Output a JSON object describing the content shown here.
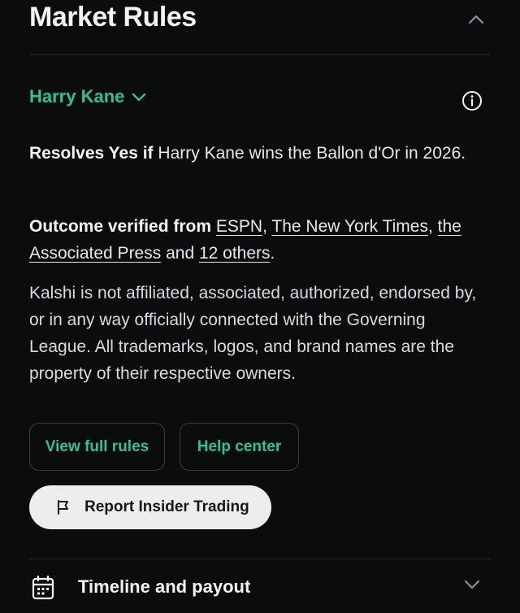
{
  "section": {
    "title": "Market Rules",
    "collapse_icon": "chevron-up-icon"
  },
  "market": {
    "name": "Harry Kane",
    "dropdown_icon": "chevron-down-icon",
    "info_icon": "info-icon"
  },
  "rules": {
    "resolves_label": "Resolves Yes if",
    "resolves_text": " Harry Kane wins the Ballon d'Or in 2026.",
    "verified_label": "Outcome verified from",
    "sources": [
      "ESPN",
      "The New York Times",
      "the Associated Press",
      "12 others"
    ],
    "sep_comma": ", ",
    "sep_and": " and ",
    "end_period": ".",
    "disclaimer": "Kalshi is not affiliated, associated, authorized, endorsed by, or in any way officially connected with the Governing League. All trademarks, logos, and brand names are the property of their respective owners."
  },
  "buttons": {
    "view_full_rules": "View full rules",
    "help_center": "Help center",
    "report_insider_trading": "Report Insider Trading",
    "report_icon": "flag-icon"
  },
  "timeline": {
    "label": "Timeline and payout",
    "icon": "calendar-icon",
    "expand_icon": "chevron-down-icon"
  },
  "colors": {
    "background": "#0b0c0e",
    "accent": "#2fc293",
    "text": "#e6e8eb",
    "divider": "#2b2e33",
    "report_button_bg": "#eceded"
  }
}
